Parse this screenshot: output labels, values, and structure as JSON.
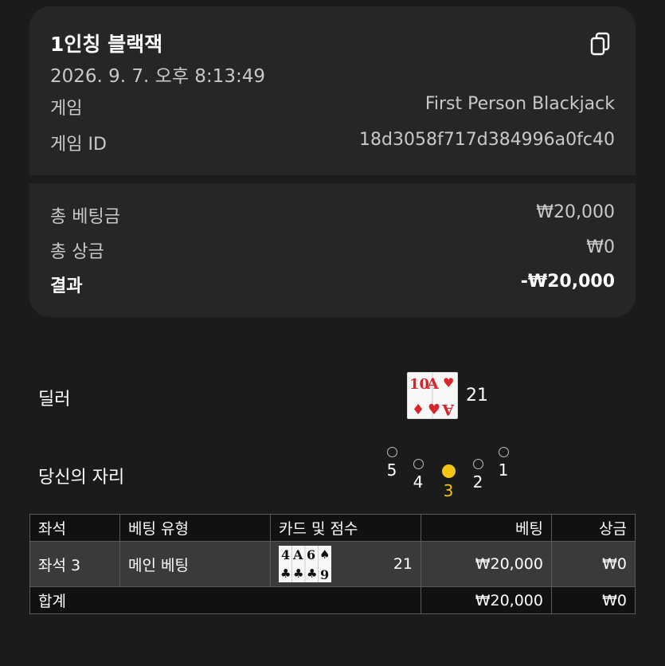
{
  "summary": {
    "title": "1인칭 블랙잭",
    "datetime": "2026. 9. 7. 오후 8:13:49",
    "game_label": "게임",
    "game_value": "First Person Blackjack",
    "game_id_label": "게임 ID",
    "game_id_value": "18d3058f717d384996a0fc40",
    "copy_icon": "copy-icon"
  },
  "totals": {
    "total_bet_label": "총 베팅금",
    "total_bet_value": "₩20,000",
    "total_win_label": "총 상금",
    "total_win_value": "₩0",
    "result_label": "결과",
    "result_value": "-₩20,000"
  },
  "dealer": {
    "label": "딜러",
    "cards": [
      "10♦",
      "A♥"
    ],
    "score": "21"
  },
  "seats": {
    "label": "당신의 자리",
    "numbers": [
      "5",
      "4",
      "3",
      "2",
      "1"
    ],
    "active": "3",
    "active_color": "#f4c514"
  },
  "table": {
    "headers": [
      "좌석",
      "베팅 유형",
      "카드 및 점수",
      "베팅",
      "상금"
    ],
    "row": {
      "seat": "좌석 3",
      "bet_type": "메인 베팅",
      "cards": [
        "4♣",
        "A♣",
        "6♠",
        "9♣"
      ],
      "score": "21",
      "bet": "₩20,000",
      "win": "₩0"
    },
    "total": {
      "label": "합계",
      "bet": "₩20,000",
      "win": "₩0"
    }
  }
}
